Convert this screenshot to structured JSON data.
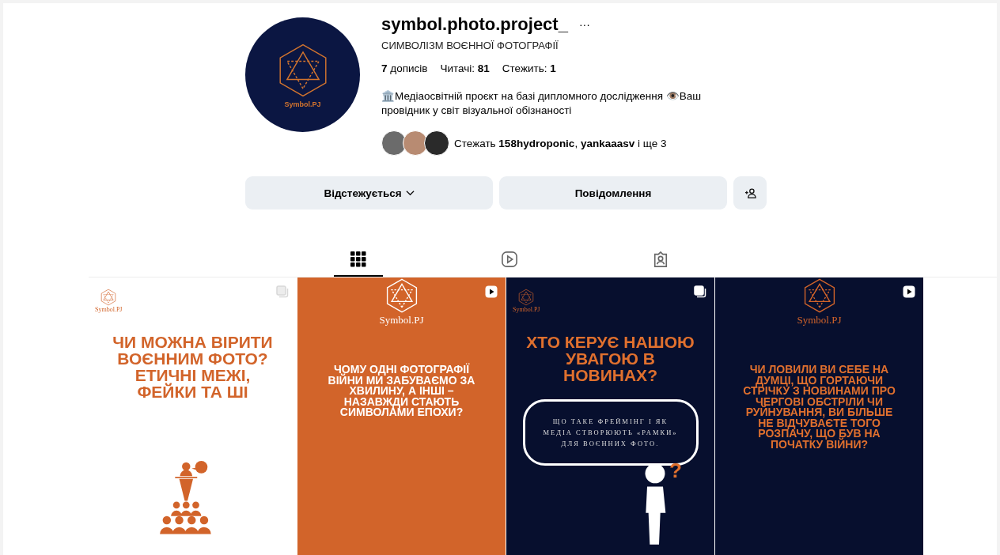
{
  "profile": {
    "username": "symbol.photo.project_",
    "more": "···",
    "avatar_logo": "Symbol.PJ",
    "full_name": "СИМВОЛІЗМ ВОЄННОЇ ФОТОГРАФІЇ",
    "stats": [
      "**7** дописів",
      "Читачі: **81**",
      "Стежить: **1**"
    ],
    "bio": "🏛️Медіаосвітній проєкт на базі дипломного дослідження 👁️Ваш провідник у світ візуальної обізнаності",
    "followed_by": {
      "avatars": [
        {
          "kind": "photo"
        },
        {
          "kind": "photo"
        },
        {
          "kind": "photo"
        }
      ],
      "text": "Стежать **158hydroponic**, **yankaaasv** і ще 3"
    }
  },
  "buttons": [
    {
      "kind": "dropdown",
      "label": "Відстежується"
    },
    {
      "kind": "plain",
      "label": "Повідомлення"
    },
    {
      "kind": "add-person"
    }
  ],
  "tabs": [
    {
      "kind": "grid",
      "selected": true
    },
    {
      "kind": "reels",
      "selected": false
    },
    {
      "kind": "tagged",
      "selected": false
    }
  ],
  "posts": [
    {
      "kind": "light",
      "badge": {
        "kind": "carousel"
      },
      "logo": {
        "kind": "corner",
        "text": "Symbol.PJ"
      },
      "headline": "ЧИ МОЖНА ВІРИТИ ВОЄННИМ ФОТО? ЕТИЧНІ МЕЖІ, ФЕЙКИ ТА ШІ",
      "figure": {
        "kind": "audience"
      }
    },
    {
      "kind": "orange",
      "badge": {
        "kind": "reel"
      },
      "logo": {
        "kind": "top",
        "text": "Symbol.PJ"
      },
      "headline": "ЧОМУ ОДНІ ФОТОГРАФІЇ ВІЙНИ МИ ЗАБУВАЄМО ЗА ХВИЛИНУ, А ІНШІ – НАЗАВЖДИ СТАЮТЬ СИМВОЛАМИ ЕПОХИ?"
    },
    {
      "kind": "dark",
      "badge": {
        "kind": "carousel"
      },
      "logo": {
        "kind": "corner",
        "text": "Symbol.PJ"
      },
      "headline": "ХТО КЕРУЄ НАШОЮ УВАГОЮ В НОВИНАХ?",
      "bubble": "ЩО ТАКЕ ФРЕЙМІНГ І ЯК МЕДІА СТВОРЮЮТЬ «РАМКИ» ДЛЯ ВОЄННИХ ФОТО.",
      "figure": {
        "kind": "thinker",
        "mark": "?"
      }
    },
    {
      "kind": "dark",
      "badge": {
        "kind": "reel"
      },
      "logo": {
        "kind": "top",
        "text": "Symbol.PJ"
      },
      "headline": "ЧИ ЛОВИЛИ ВИ СЕБЕ НА ДУМЦІ, ЩО ГОРТАЮЧИ СТРІЧКУ З НОВИНАМИ ПРО ЧЕРГОВІ ОБСТРІЛИ ЧИ РУЙНУВАННЯ, ВИ БІЛЬШЕ НЕ ВІДЧУВАЄТЕ ТОГО РОЗПАЧУ, ЩО БУВ НА ПОЧАТКУ ВІЙНИ?"
    }
  ]
}
